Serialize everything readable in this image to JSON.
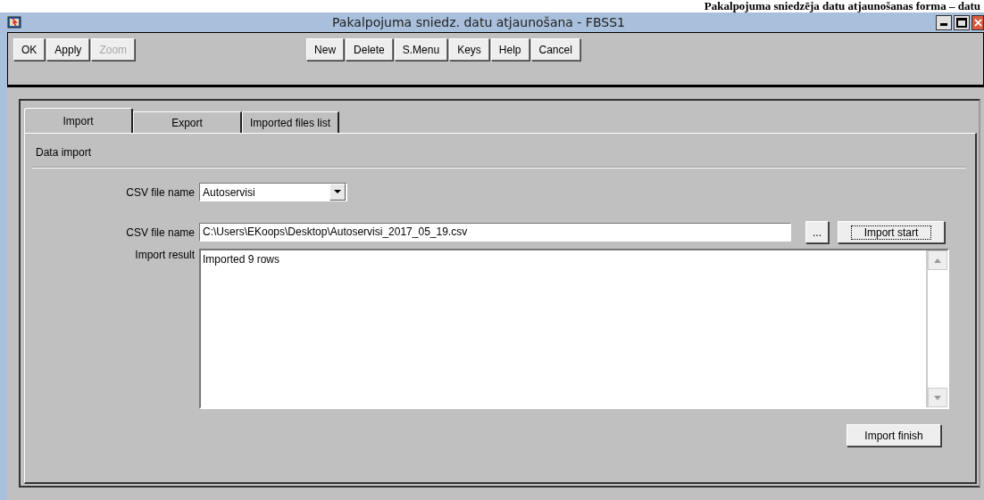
{
  "document_heading": "Pakalpojuma sniedzēja datu atjaunošanas forma – datu",
  "window": {
    "title": "Pakalpojuma sniedz. datu atjaunošana - FBSS1"
  },
  "toolbar": {
    "left": [
      {
        "label": "OK",
        "disabled": false
      },
      {
        "label": "Apply",
        "disabled": false
      },
      {
        "label": "Zoom",
        "disabled": true
      }
    ],
    "center": [
      {
        "label": "New",
        "disabled": false
      },
      {
        "label": "Delete",
        "disabled": false
      },
      {
        "label": "S.Menu",
        "disabled": false
      },
      {
        "label": "Keys",
        "disabled": false
      },
      {
        "label": "Help",
        "disabled": false
      },
      {
        "label": "Cancel",
        "disabled": false
      }
    ]
  },
  "tabs": [
    {
      "label": "Import",
      "selected": true
    },
    {
      "label": "Export",
      "selected": false
    },
    {
      "label": "Imported files list",
      "selected": false
    }
  ],
  "section_title": "Data import",
  "csv_select": {
    "label": "CSV file name",
    "value": "Autoservisi"
  },
  "csv_path": {
    "label": "CSV file name",
    "value": "C:\\Users\\EKoops\\Desktop\\Autoservisi_2017_05_19.csv"
  },
  "browse_button": {
    "label": "...",
    "focused": false
  },
  "import_start_button": {
    "label": "Import start",
    "focused": true
  },
  "import_result": {
    "label": "Import result",
    "value": "Imported 9 rows"
  },
  "import_finish_button": {
    "label": "Import finish",
    "focused": false
  }
}
